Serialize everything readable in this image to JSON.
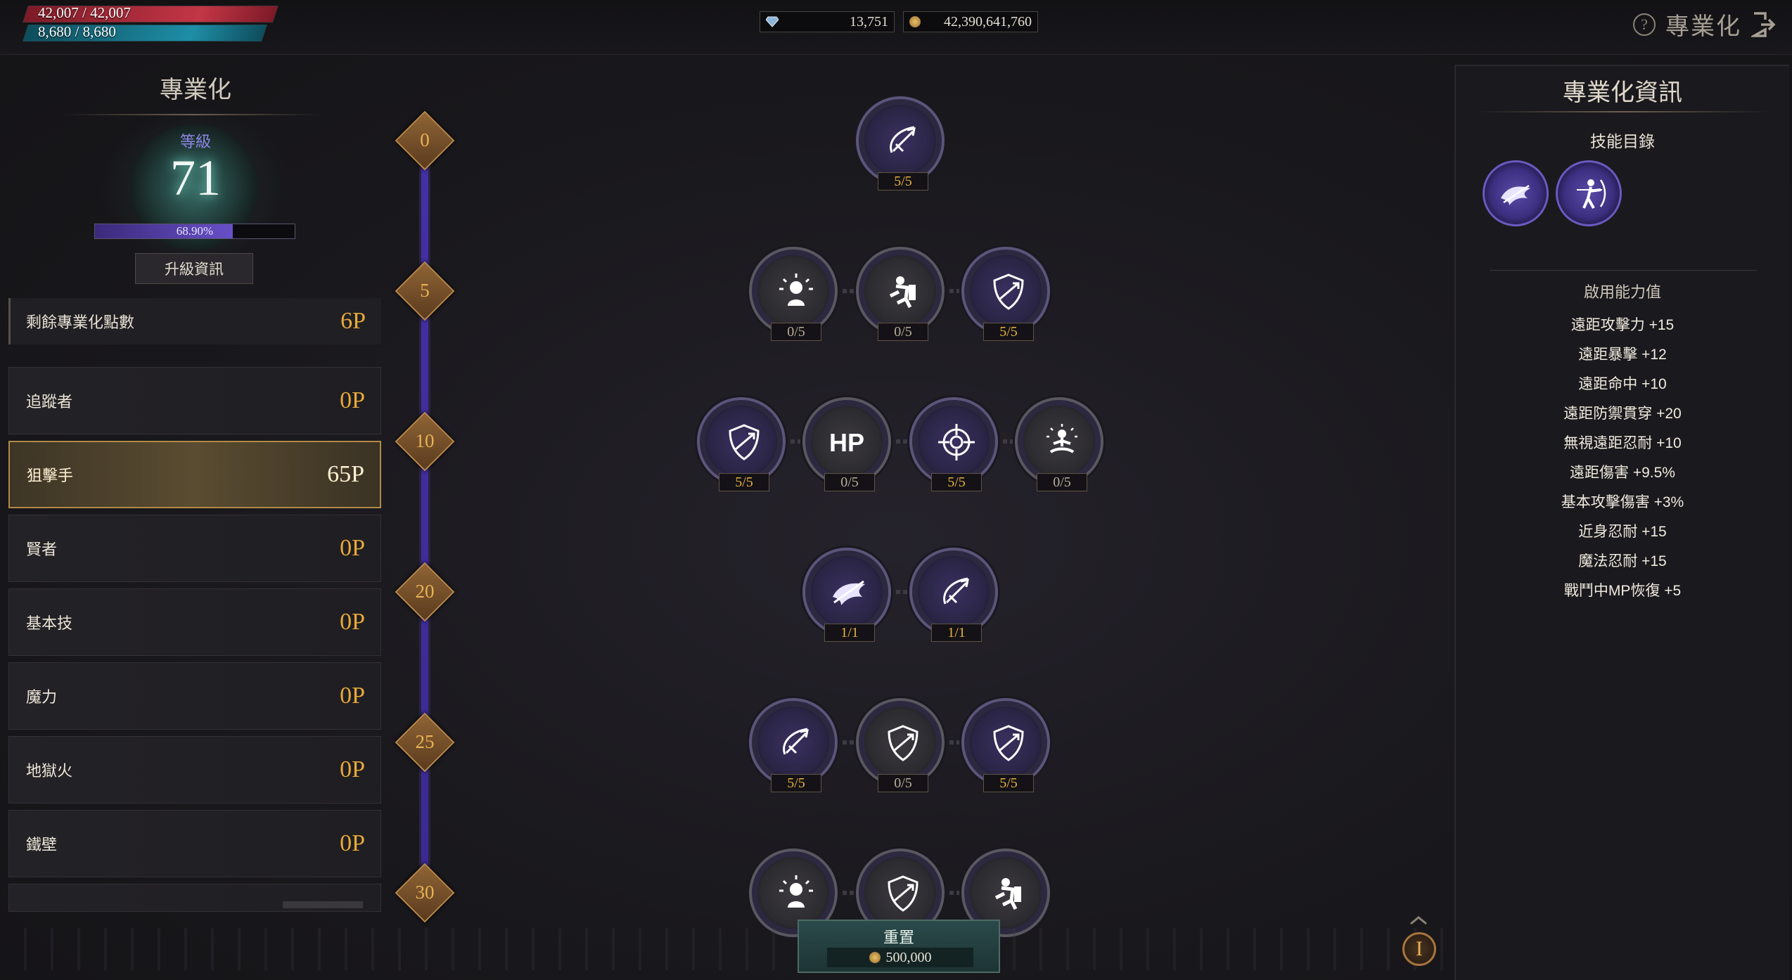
{
  "player": {
    "hp_text": "42,007  /  42,007",
    "mp_text": "8,680  /  8,680"
  },
  "currencies": {
    "gems": "13,751",
    "gold": "42,390,641,760",
    "gem_icon": "diamond-icon",
    "gold_icon": "gold-coin-icon"
  },
  "header": {
    "title": "專業化",
    "help_icon": "question-circle-icon",
    "exit_icon": "exit-door-icon"
  },
  "left_panel": {
    "title": "專業化",
    "level_label": "等級",
    "level": "71",
    "exp_text": "68.90%",
    "exp_fraction": 0.689,
    "level_info_button": "升級資訊",
    "remaining_label": "剩餘專業化點數",
    "remaining_points": "6P",
    "items": [
      {
        "label": "追蹤者",
        "points": "0P"
      },
      {
        "label": "狙擊手",
        "points": "65P"
      },
      {
        "label": "賢者",
        "points": "0P"
      },
      {
        "label": "基本技",
        "points": "0P"
      },
      {
        "label": "魔力",
        "points": "0P"
      },
      {
        "label": "地獄火",
        "points": "0P"
      },
      {
        "label": "鐵壁",
        "points": "0P"
      }
    ],
    "active_item": "狙擊手"
  },
  "track": {
    "levels": [
      "0",
      "5",
      "10",
      "20",
      "25",
      "30"
    ]
  },
  "skill_tree": {
    "nodes": [
      {
        "icon": "bow-icon",
        "status": "5/5",
        "active": true
      },
      {
        "icon": "burst-person-icon",
        "status": "0/5",
        "active": false
      },
      {
        "icon": "crouch-guard-icon",
        "status": "0/5",
        "active": false
      },
      {
        "icon": "shield-icon",
        "status": "5/5",
        "active": true
      },
      {
        "icon": "shield-icon",
        "status": "5/5",
        "active": true
      },
      {
        "icon": "hp-text-icon",
        "label": "HP",
        "status": "0/5",
        "active": false
      },
      {
        "icon": "crosshair-icon",
        "status": "5/5",
        "active": true
      },
      {
        "icon": "meditate-icon",
        "status": "0/5",
        "active": false
      },
      {
        "icon": "dragon-icon",
        "status": "1/1",
        "active": true
      },
      {
        "icon": "bow-icon",
        "status": "1/1",
        "active": true
      },
      {
        "icon": "bow-icon",
        "status": "5/5",
        "active": true
      },
      {
        "icon": "shield-icon",
        "status": "0/5",
        "active": false
      },
      {
        "icon": "shield-icon",
        "status": "5/5",
        "active": true
      },
      {
        "icon": "burst-person-icon",
        "status": "",
        "active": false
      },
      {
        "icon": "shield-icon",
        "status": "",
        "active": false
      },
      {
        "icon": "crouch-guard-icon",
        "status": "",
        "active": false
      }
    ]
  },
  "right_panel": {
    "title": "專業化資訊",
    "skill_list_label": "技能目錄",
    "skills": [
      "dragon-shot-icon",
      "archer-icon"
    ],
    "stats_label": "啟用能力值",
    "stats": [
      "遠距攻擊力 +15",
      "遠距暴擊 +12",
      "遠距命中 +10",
      "遠距防禦貫穿 +20",
      "無視遠距忍耐 +10",
      "遠距傷害 +9.5%",
      "基本攻擊傷害 +3%",
      "近身忍耐 +15",
      "魔法忍耐 +15",
      "戰鬥中MP恢復 +5"
    ]
  },
  "footer": {
    "reset_label": "重置",
    "reset_cost": "500,000",
    "info_button": "I"
  },
  "colors": {
    "accent_gold": "#e8a93a",
    "hp_red": "#c33646",
    "mp_teal": "#1e8ea6",
    "track_purple": "#4430a6",
    "node_active": "#3a3060"
  }
}
